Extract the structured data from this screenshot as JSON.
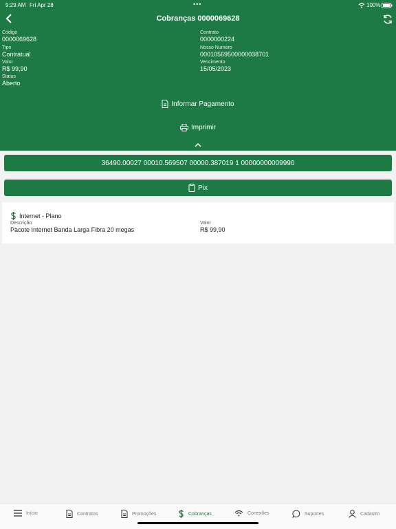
{
  "status_bar": {
    "time": "9:29 AM",
    "date": "Fri Apr 28",
    "dots": "•••",
    "battery": "100%"
  },
  "header": {
    "title": "Cobranças 0000069628"
  },
  "fields": {
    "codigo": {
      "label": "Código",
      "value": "0000069628"
    },
    "contrato": {
      "label": "Contrato",
      "value": "0000000224"
    },
    "tipo": {
      "label": "Tipo",
      "value": "Contratual"
    },
    "nosso_numero": {
      "label": "Nosso Numero",
      "value": "00010569500000038701"
    },
    "valor": {
      "label": "Valor",
      "value": "R$ 99,90"
    },
    "vencimento": {
      "label": "Vencimento",
      "value": "15/05/2023"
    },
    "status": {
      "label": "Status",
      "value": "Aberto"
    }
  },
  "actions": {
    "informar": "Informar Pagamento",
    "imprimir": "Imprimir"
  },
  "barcode": "36490.00027 00010.569507 00000.387019 1 00000000009990",
  "pix_label": "Pix",
  "item": {
    "title": "Internet - Plano",
    "descricao_label": "Descrição",
    "descricao": "Pacote Internet Banda Larga Fibra 20 megas",
    "valor_label": "Valor",
    "valor": "R$ 99,90"
  },
  "tabs": [
    {
      "label": "Início",
      "icon": "menu-icon"
    },
    {
      "label": "Contratos",
      "icon": "document-icon"
    },
    {
      "label": "Promoções",
      "icon": "document-icon"
    },
    {
      "label": "Cobranças",
      "icon": "dollar-icon",
      "active": true
    },
    {
      "label": "Conexões",
      "icon": "wifi-icon"
    },
    {
      "label": "Suportes",
      "icon": "chat-icon"
    },
    {
      "label": "Cadastro",
      "icon": "person-icon"
    }
  ],
  "colors": {
    "primary": "#1d7a45",
    "background": "#f2f2f2"
  }
}
